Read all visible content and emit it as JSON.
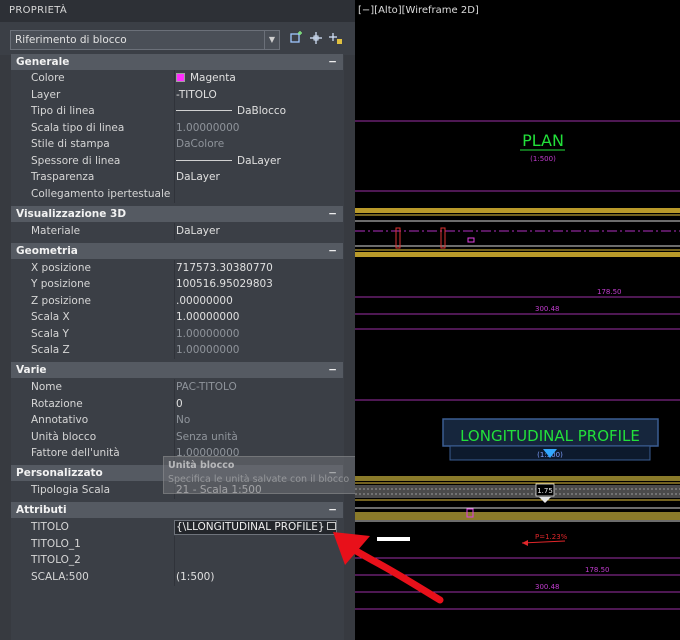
{
  "palette": {
    "title": "PROPRIETÀ",
    "selector": "Riferimento di blocco",
    "tools": [
      "quick-select-icon",
      "select-objects-icon",
      "toggle-pickadd-icon"
    ],
    "collapse_symbol": "−",
    "sections": {
      "generale": "Generale",
      "visual3d": "Visualizzazione 3D",
      "geometria": "Geometria",
      "varie": "Varie",
      "personalizzato": "Personalizzato",
      "attributi": "Attributi"
    },
    "generale": {
      "colore_k": "Colore",
      "colore_v": "Magenta",
      "colore_hex": "#ff2cff",
      "layer_k": "Layer",
      "layer_v": "-TITOLO",
      "tipo_linea_k": "Tipo di linea",
      "tipo_linea_v": "DaBlocco",
      "scala_tipo_k": "Scala tipo di linea",
      "scala_tipo_v": "1.00000000",
      "stile_stampa_k": "Stile di stampa",
      "stile_stampa_v": "DaColore",
      "spessore_k": "Spessore di linea",
      "spessore_v": "DaLayer",
      "trasparenza_k": "Trasparenza",
      "trasparenza_v": "DaLayer",
      "collegamento_k": "Collegamento ipertestuale",
      "collegamento_v": ""
    },
    "visual3d": {
      "materiale_k": "Materiale",
      "materiale_v": "DaLayer"
    },
    "geometria": {
      "x_k": "X posizione",
      "x_v": "717573.30380770",
      "y_k": "Y posizione",
      "y_v": "100516.95029803",
      "z_k": "Z posizione",
      "z_v": ".00000000",
      "sx_k": "Scala X",
      "sx_v": "1.00000000",
      "sy_k": "Scala Y",
      "sy_v": "1.00000000",
      "sz_k": "Scala Z",
      "sz_v": "1.00000000"
    },
    "varie": {
      "nome_k": "Nome",
      "nome_v": "PAC-TITOLO",
      "rotazione_k": "Rotazione",
      "rotazione_v": "0",
      "annotativo_k": "Annotativo",
      "annotativo_v": "No",
      "unita_k": "Unità blocco",
      "unita_v": "Senza unità",
      "fattore_k": "Fattore dell'unità",
      "fattore_v": "1.00000000"
    },
    "personalizzato": {
      "tipologia_k": "Tipologia Scala",
      "tipologia_v": "21 - Scala 1:500"
    },
    "attributi": {
      "titolo_k": "TITOLO",
      "titolo_v": "{\\LLONGITUDINAL PROFILE}",
      "titolo1_k": "TITOLO_1",
      "titolo1_v": "",
      "titolo2_k": "TITOLO_2",
      "titolo2_v": "",
      "scala_k": "SCALA:500",
      "scala_v": "(1:500)"
    },
    "tooltip": {
      "title": "Unità blocco",
      "text": "Specifica le unità salvate con il blocco"
    }
  },
  "viewport": {
    "label": "[−][Alto][Wireframe 2D]",
    "plan_title": "PLAN",
    "plan_scale": "(1:500)",
    "dim1": "178.50",
    "dim2": "300.48",
    "profile_title": "LONGITUDINAL PROFILE",
    "profile_scale": "(1:500)",
    "marker": "1.75",
    "slope": "P=1.23%",
    "dim3": "178.50",
    "dim4": "300.48"
  }
}
